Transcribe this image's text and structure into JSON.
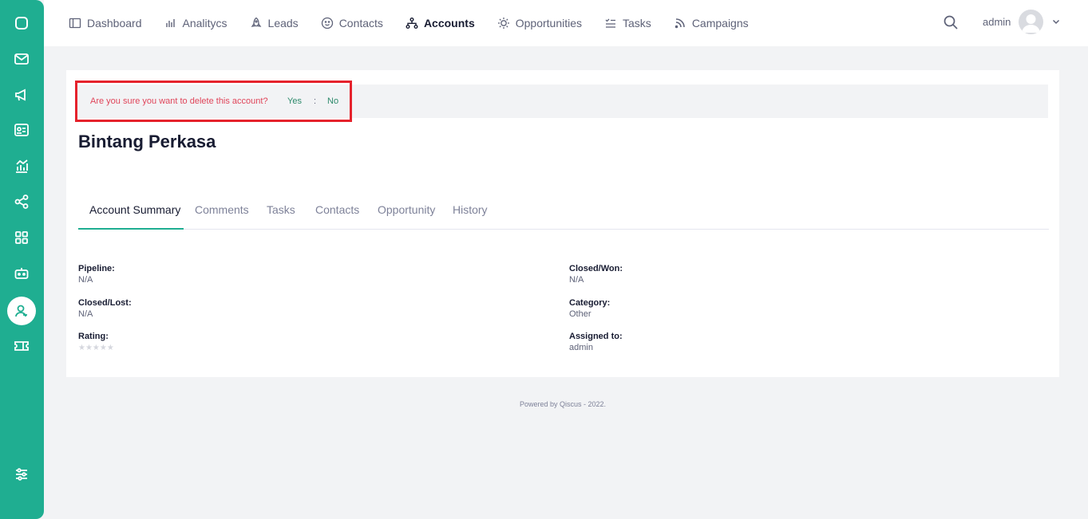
{
  "sidebar": {
    "items": [
      {
        "icon": "chat-icon"
      },
      {
        "icon": "mail-icon"
      },
      {
        "icon": "megaphone-icon"
      },
      {
        "icon": "contact-card-icon"
      },
      {
        "icon": "analytics-icon"
      },
      {
        "icon": "share-icon"
      },
      {
        "icon": "apps-grid-icon"
      },
      {
        "icon": "bot-icon"
      },
      {
        "icon": "crm-user-icon",
        "active": true
      },
      {
        "icon": "ticket-icon"
      },
      {
        "icon": "settings-sliders-icon"
      }
    ]
  },
  "nav": {
    "items": [
      {
        "label": "Dashboard",
        "icon": "dashboard-icon"
      },
      {
        "label": "Analitycs",
        "icon": "bar-chart-icon"
      },
      {
        "label": "Leads",
        "icon": "rocket-icon"
      },
      {
        "label": "Contacts",
        "icon": "smiley-icon"
      },
      {
        "label": "Accounts",
        "icon": "hierarchy-icon",
        "active": true
      },
      {
        "label": "Opportunities",
        "icon": "sun-icon"
      },
      {
        "label": "Tasks",
        "icon": "task-list-icon"
      },
      {
        "label": "Campaigns",
        "icon": "rss-icon"
      }
    ],
    "user_name": "admin"
  },
  "confirm": {
    "message": "Are you sure you want to delete this account?",
    "yes_label": "Yes",
    "separator": ":",
    "no_label": "No"
  },
  "account": {
    "name": "Bintang Perkasa"
  },
  "tabs": [
    {
      "label": "Account Summary",
      "active": true
    },
    {
      "label": "Comments"
    },
    {
      "label": "Tasks"
    },
    {
      "label": "Contacts"
    },
    {
      "label": "Opportunity"
    },
    {
      "label": "History"
    }
  ],
  "summary": {
    "pipeline_label": "Pipeline:",
    "pipeline_value": "N/A",
    "closed_won_label": "Closed/Won:",
    "closed_won_value": "N/A",
    "closed_lost_label": "Closed/Lost:",
    "closed_lost_value": "N/A",
    "category_label": "Category:",
    "category_value": "Other",
    "rating_label": "Rating:",
    "rating_stars": "★★★★★",
    "rating_value": 0,
    "rating_max": 5,
    "assigned_label": "Assigned to:",
    "assigned_value": "admin"
  },
  "footer": {
    "text": "Powered by Qiscus - 2022."
  },
  "colors": {
    "brand": "#1fae91",
    "alert": "#e0455a",
    "highlight_border": "#e5222c"
  }
}
